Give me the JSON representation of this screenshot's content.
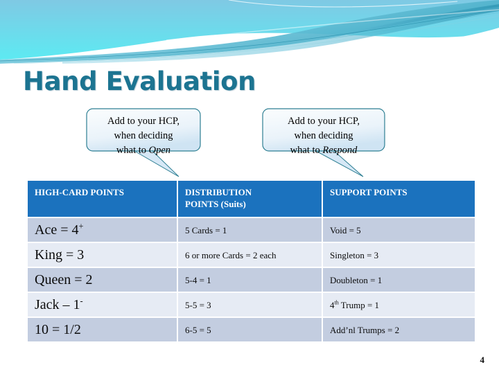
{
  "slide": {
    "title": "Hand Evaluation",
    "page_number": "4",
    "title_color": "#1C7491",
    "header_color": "#1B72BE",
    "row_alt_colors": [
      "#C3CDE0",
      "#E6EBF4"
    ],
    "banner_colors": [
      "#7EC8E3",
      "#5FE8F0",
      "#6BB8CC",
      "#2E9FBD",
      "#1C7491"
    ]
  },
  "callouts": [
    {
      "id": "open",
      "line1": "Add to your HCP,",
      "line2": "when deciding",
      "line3_prefix": "what to ",
      "line3_emphasis": "Open"
    },
    {
      "id": "respond",
      "line1": "Add to your HCP,",
      "line2": "when deciding",
      "line3_prefix": "what to ",
      "line3_emphasis": "Respond"
    }
  ],
  "table": {
    "headers": {
      "col1": "HIGH-CARD POINTS",
      "col2_line1": "DISTRIBUTION",
      "col2_line2": "POINTS (Suits)",
      "col3": "SUPPORT  POINTS"
    },
    "rows": [
      {
        "c1_text": "Ace = 4",
        "c1_sup": "+",
        "c2": "5 Cards = 1",
        "c3_text": "Void = 5",
        "c3_sup": ""
      },
      {
        "c1_text": "King = 3",
        "c1_sup": "",
        "c2": "6 or more Cards = 2 each",
        "c3_text": "Singleton = 3",
        "c3_sup": ""
      },
      {
        "c1_text": "Queen = 2",
        "c1_sup": "",
        "c2": "5-4 = 1",
        "c3_text": "Doubleton = 1",
        "c3_sup": ""
      },
      {
        "c1_text": "Jack – 1",
        "c1_sup": "-",
        "c2": "5-5 = 3",
        "c3_text": "4",
        "c3_sup": "th",
        "c3_tail": " Trump = 1"
      },
      {
        "c1_text": "10 = 1/2",
        "c1_sup": "",
        "c2": "6-5 = 5",
        "c3_text": "Add’nl Trumps = 2",
        "c3_sup": ""
      }
    ]
  }
}
